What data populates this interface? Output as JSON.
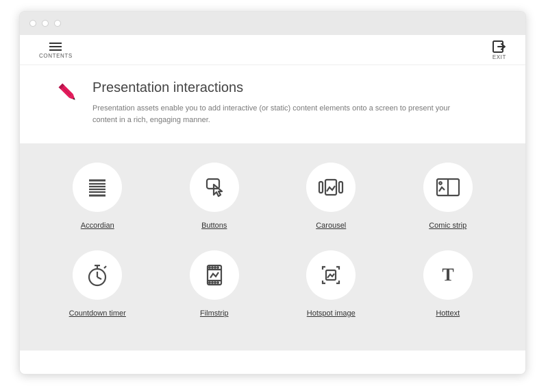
{
  "topbar": {
    "contents_label": "CONTENTS",
    "exit_label": "EXIT"
  },
  "header": {
    "title": "Presentation interactions",
    "description": "Presentation assets enable you to add interactive (or static) content elements onto a screen to present your content in a rich, engaging manner."
  },
  "items": [
    {
      "label": "Accordian",
      "icon": "accordion-icon"
    },
    {
      "label": "Buttons",
      "icon": "buttons-icon"
    },
    {
      "label": "Carousel",
      "icon": "carousel-icon"
    },
    {
      "label": "Comic strip",
      "icon": "comic-strip-icon"
    },
    {
      "label": "Countdown timer",
      "icon": "countdown-timer-icon"
    },
    {
      "label": "Filmstrip",
      "icon": "filmstrip-icon"
    },
    {
      "label": "Hotspot image",
      "icon": "hotspot-image-icon"
    },
    {
      "label": "Hottext",
      "icon": "hottext-icon"
    }
  ],
  "colors": {
    "accent": "#e31b5b",
    "icon_stroke": "#4a4a4a"
  }
}
